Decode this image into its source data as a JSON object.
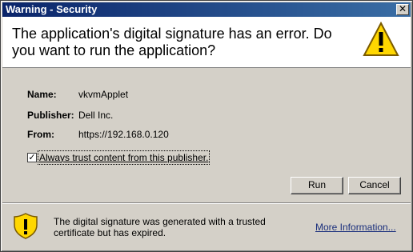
{
  "window": {
    "title": "Warning - Security",
    "close_glyph": "✕"
  },
  "header": {
    "message": "The application's digital signature has an error.  Do you want to run the application?",
    "icon": "warning-triangle-icon"
  },
  "details": {
    "name_label": "Name:",
    "name_value": "vkvmApplet",
    "publisher_label": "Publisher:",
    "publisher_value": "Dell Inc.",
    "from_label": "From:",
    "from_value": "https://192.168.0.120"
  },
  "trust": {
    "checked": true,
    "check_glyph": "✓",
    "label": "Always trust content from this publisher."
  },
  "buttons": {
    "run_label": "Run",
    "cancel_label": "Cancel"
  },
  "footer": {
    "icon": "warning-shield-icon",
    "message": "The digital signature was generated with a trusted certificate but has expired.",
    "more_info_label": "More Information..."
  },
  "colors": {
    "title_bar_start": "#0a246a",
    "title_bar_end": "#3a6ea5",
    "warning_yellow": "#ffd700",
    "link_color": "#1a2f7c"
  }
}
